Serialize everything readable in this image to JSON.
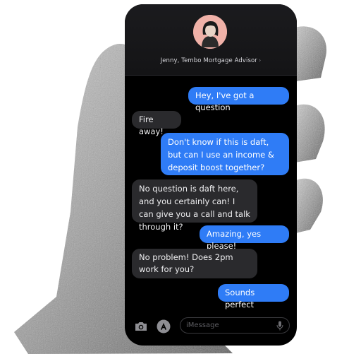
{
  "conversation": {
    "contact_name": "Jenny, Tembo Mortgage Advisor",
    "chevron": "›",
    "messages": [
      {
        "from": "me",
        "text": "Hey, I've got a question"
      },
      {
        "from": "them",
        "text": "Fire away!"
      },
      {
        "from": "me",
        "text": "Don't know if this is daft, but can I use an income & deposit boost together?"
      },
      {
        "from": "them",
        "text": "No question is daft here, and you certainly can! I can give you a call and talk through it?"
      },
      {
        "from": "me",
        "text": "Amazing, yes please!"
      },
      {
        "from": "them",
        "text": "No problem! Does 2pm work for you?"
      },
      {
        "from": "me",
        "text": "Sounds perfect"
      }
    ]
  },
  "toolbar": {
    "camera_icon": "camera-icon",
    "apps_icon": "app-store-icon",
    "input_placeholder": "iMessage",
    "mic_icon": "microphone-icon"
  },
  "colors": {
    "outgoing_bubble": "#2f7cf6",
    "incoming_bubble": "#2a2a2d",
    "avatar_bg": "#f0b1a8"
  }
}
